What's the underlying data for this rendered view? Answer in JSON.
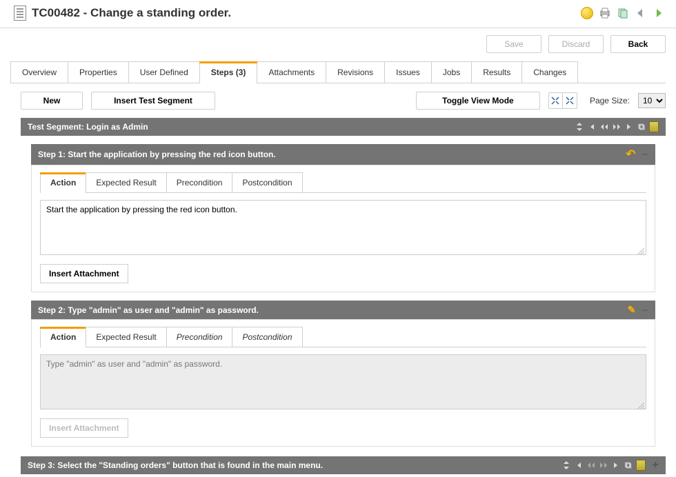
{
  "header": {
    "title": "TC00482 - Change a standing order."
  },
  "actions": {
    "save": "Save",
    "discard": "Discard",
    "back": "Back"
  },
  "tabs": [
    "Overview",
    "Properties",
    "User Defined",
    "Steps (3)",
    "Attachments",
    "Revisions",
    "Issues",
    "Jobs",
    "Results",
    "Changes"
  ],
  "active_tab": 3,
  "toolbar": {
    "new": "New",
    "insert_segment": "Insert Test Segment",
    "toggle_view": "Toggle View Mode",
    "page_size_label": "Page Size:",
    "page_size_value": "10"
  },
  "segment": {
    "label": "Test Segment: Login as Admin"
  },
  "steps": [
    {
      "header": "Step 1: Start the application by pressing the red icon button.",
      "text": "Start the application by pressing the red icon button.",
      "editable": true,
      "tabs": [
        "Action",
        "Expected Result",
        "Precondition",
        "Postcondition"
      ],
      "italic_tabs": [],
      "insert_attachment": "Insert Attachment"
    },
    {
      "header": "Step 2: Type \"admin\" as user and \"admin\" as password.",
      "text": "Type \"admin\" as user and \"admin\" as password.",
      "editable": false,
      "tabs": [
        "Action",
        "Expected Result",
        "Precondition",
        "Postcondition"
      ],
      "italic_tabs": [
        2,
        3
      ],
      "insert_attachment": "Insert Attachment"
    },
    {
      "header": "Step 3: Select the \"Standing orders\" button that is found in the main menu."
    }
  ]
}
